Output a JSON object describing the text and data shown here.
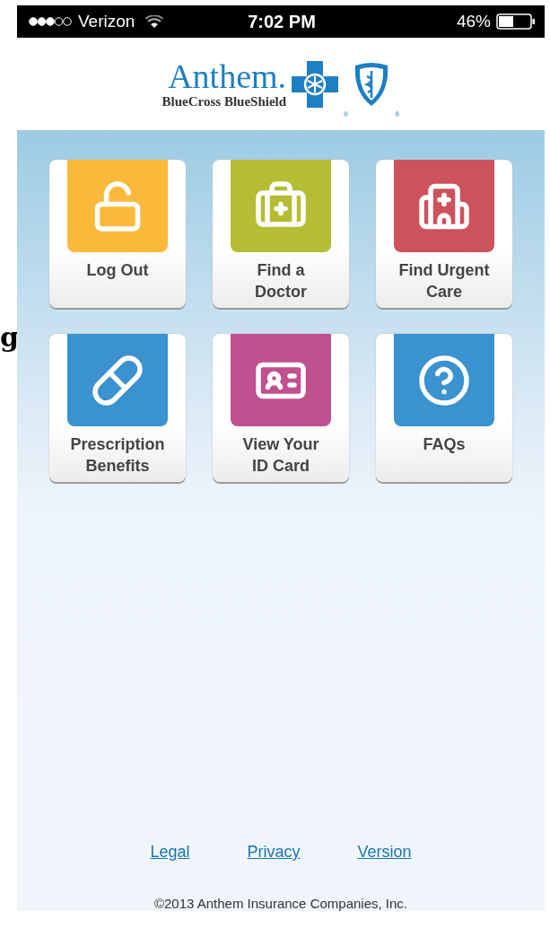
{
  "stray_text": "g",
  "status_bar": {
    "carrier": "Verizon",
    "time": "7:02 PM",
    "battery": "46%"
  },
  "logo": {
    "wordmark": "Anthem.",
    "tagline": "BlueCross BlueShield",
    "marks": [
      "®",
      "®"
    ]
  },
  "tiles": [
    {
      "label": "Log Out",
      "color": "#fbb93b",
      "kind": "lock"
    },
    {
      "label": "Find a\nDoctor",
      "color": "#b4bd33",
      "kind": "kit"
    },
    {
      "label": "Find Urgent\nCare",
      "color": "#cc525c",
      "kind": "hospital"
    },
    {
      "label": "Prescription\nBenefits",
      "color": "#3a92d0",
      "kind": "pill"
    },
    {
      "label": "View Your\nID Card",
      "color": "#c1508e",
      "kind": "card"
    },
    {
      "label": "FAQs",
      "color": "#3a92d0",
      "kind": "help"
    }
  ],
  "links": [
    "Legal",
    "Privacy",
    "Version"
  ],
  "copyright": "©2013 Anthem Insurance Companies, Inc."
}
